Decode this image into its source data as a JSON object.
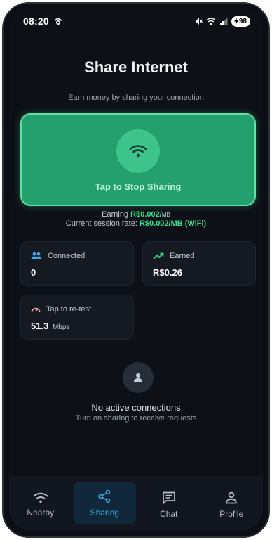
{
  "status_bar": {
    "time": "08:20",
    "battery": "98"
  },
  "header": {
    "title": "Share Internet",
    "subtitle": "Earn money by sharing your connection"
  },
  "share_button": {
    "label": "Tap to Stop Sharing",
    "icon": "wifi-icon",
    "color": "#23a06d"
  },
  "earning": {
    "prefix": "Earning",
    "value": "R$0.002/",
    "unit": "MB",
    "rate_label": "Current session rate:",
    "rate_value": "R$0.002/MB (WiFi)"
  },
  "stats": {
    "connected": {
      "label": "Connected",
      "value": "0",
      "icon": "users-icon"
    },
    "earned": {
      "label": "Earned",
      "value": "R$0.26",
      "icon": "trending-up-icon"
    },
    "speed": {
      "label": "Tap to re-test",
      "value": "51.3",
      "unit": "Mbps",
      "icon": "speedometer-icon"
    }
  },
  "empty_state": {
    "title": "No active connections",
    "subtitle": "Turn on sharing to receive requests",
    "icon": "person-icon"
  },
  "nav": {
    "items": [
      {
        "label": "Nearby",
        "icon": "wifi-icon"
      },
      {
        "label": "Sharing",
        "icon": "share-icon",
        "active": true
      },
      {
        "label": "Chat",
        "icon": "chat-icon"
      },
      {
        "label": "Profile",
        "icon": "person-icon"
      }
    ]
  },
  "colors": {
    "accent_green": "#3fe08c",
    "accent_blue": "#3fa6e4",
    "background": "#0d1117"
  }
}
